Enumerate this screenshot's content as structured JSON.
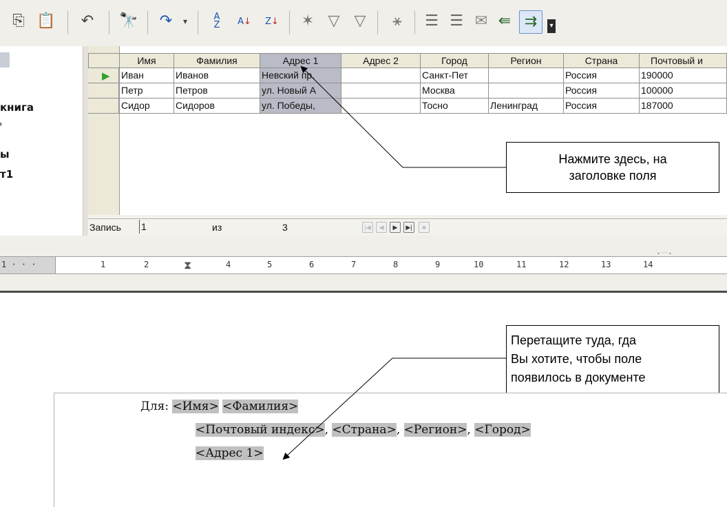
{
  "toolbar": {
    "icons": [
      "copy-icon",
      "paste-icon",
      "undo-icon",
      "find-icon",
      "redo-icon",
      "sort-ascending-icon",
      "sort-az-icon",
      "sort-za-icon",
      "autofilter-icon",
      "standard-filter-icon",
      "filter-icon",
      "remove-filter-icon",
      "insert-data-icon",
      "data-to-fields-icon",
      "mail-merge-icon",
      "explorer-icon",
      "data-to-text-icon"
    ]
  },
  "left_panel": {
    "items": [
      "книга",
      "ы",
      "т1"
    ]
  },
  "grid": {
    "columns": [
      "Имя",
      "Фамилия",
      "Адрес 1",
      "Адрес 2",
      "Город",
      "Регион",
      "Страна",
      "Почтовый и"
    ],
    "selected_column": "Адрес 1",
    "rows": [
      [
        "Иван",
        "Иванов",
        "Невский пр.",
        "",
        "Санкт-Пет",
        "",
        "Россия",
        "190000"
      ],
      [
        "Петр",
        "Петров",
        "ул. Новый А",
        "",
        "Москва",
        "",
        "Россия",
        "100000"
      ],
      [
        "Сидор",
        "Сидоров",
        "ул. Победы,",
        "",
        "Тосно",
        "Ленинград",
        "Россия",
        "187000"
      ]
    ],
    "nav": {
      "record_label": "Запись",
      "record_value": "1",
      "of_label": "из",
      "total": "3"
    }
  },
  "ruler": {
    "left_label": "1 · · ·",
    "numbers": [
      "1",
      "2",
      "3",
      "4",
      "5",
      "6",
      "7",
      "8",
      "9",
      "10",
      "11",
      "12",
      "13",
      "14"
    ]
  },
  "callouts": {
    "top": "Нажмите здесь, на заголовке поля",
    "top_line1": "Нажмите здесь, на",
    "top_line2": "заголовке поля",
    "bottom_line1": "Перетащите туда, гда",
    "bottom_line2": "Вы хотите, чтобы поле",
    "bottom_line3": "появилось в документе"
  },
  "document": {
    "prefix": "Для:",
    "line1_fields": [
      "<Имя>",
      "<Фамилия>"
    ],
    "line2_fields": [
      "<Почтовый индекс>",
      "<Страна>",
      "<Регион>",
      "<Город>"
    ],
    "line3_fields": [
      "<Адрес 1>"
    ],
    "separator": ", "
  },
  "colors": {
    "selection": "#b9bcc6",
    "field_shade": "#c0c0c0",
    "toolbar_bg": "#f0efea",
    "record_pointer": "#2ea02e"
  }
}
